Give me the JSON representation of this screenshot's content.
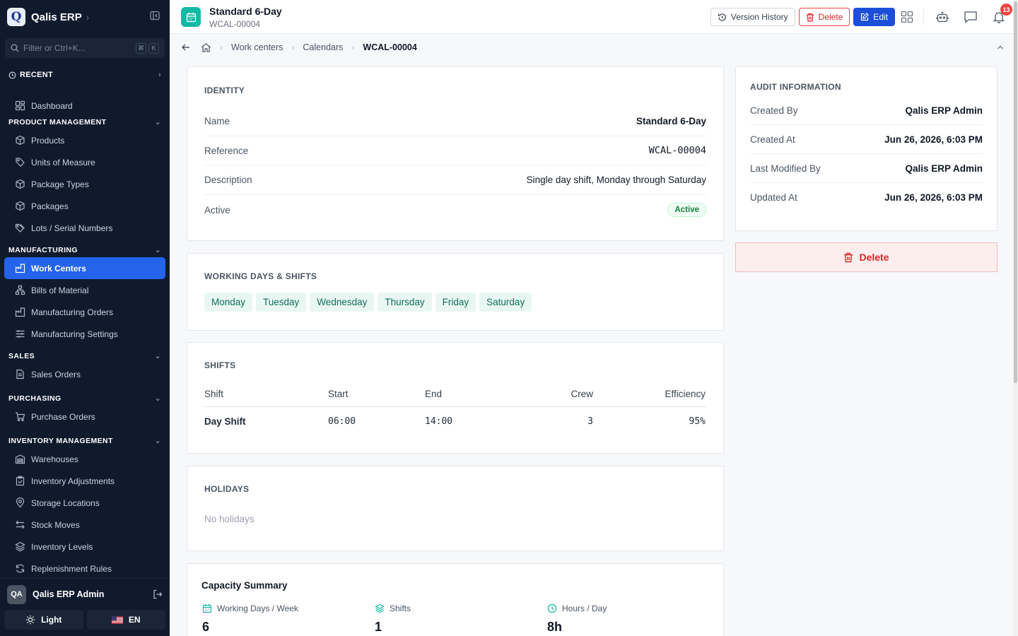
{
  "app": {
    "brand": "Qalis ERP",
    "logo_letter": "Q"
  },
  "sidebar": {
    "search_placeholder": "Filter or Ctrl+K...",
    "kbd1": "⌘",
    "kbd2": "K",
    "recent_label": "RECENT",
    "dashboard": "Dashboard",
    "sections": [
      {
        "title": "PRODUCT MANAGEMENT",
        "items": [
          "Products",
          "Units of Measure",
          "Package Types",
          "Packages",
          "Lots / Serial Numbers"
        ]
      },
      {
        "title": "MANUFACTURING",
        "items": [
          "Work Centers",
          "Bills of Material",
          "Manufacturing Orders",
          "Manufacturing Settings"
        ]
      },
      {
        "title": "SALES",
        "items": [
          "Sales Orders"
        ]
      },
      {
        "title": "PURCHASING",
        "items": [
          "Purchase Orders"
        ]
      },
      {
        "title": "INVENTORY MANAGEMENT",
        "items": [
          "Warehouses",
          "Inventory Adjustments",
          "Storage Locations",
          "Stock Moves",
          "Inventory Levels",
          "Replenishment Rules"
        ]
      }
    ],
    "user": {
      "initials": "QA",
      "name": "Qalis ERP Admin"
    },
    "theme_label": "Light",
    "lang_label": "EN",
    "lang_flag": "🇺🇸"
  },
  "header": {
    "title": "Standard 6-Day",
    "subtitle": "WCAL-00004",
    "version_history": "Version History",
    "delete": "Delete",
    "edit": "Edit",
    "notif_count": "13"
  },
  "breadcrumb": [
    "Work centers",
    "Calendars",
    "WCAL-00004"
  ],
  "identity": {
    "title": "IDENTITY",
    "rows": [
      {
        "k": "Name",
        "v": "Standard 6-Day"
      },
      {
        "k": "Reference",
        "v": "WCAL-00004"
      },
      {
        "k": "Description",
        "v": "Single day shift, Monday through Saturday"
      },
      {
        "k": "Active",
        "v": "Active"
      }
    ]
  },
  "working_days": {
    "title": "WORKING DAYS & SHIFTS",
    "days": [
      "Monday",
      "Tuesday",
      "Wednesday",
      "Thursday",
      "Friday",
      "Saturday"
    ]
  },
  "shifts": {
    "title": "SHIFTS",
    "headers": [
      "Shift",
      "Start",
      "End",
      "Crew",
      "Efficiency"
    ],
    "rows": [
      {
        "name": "Day Shift",
        "start": "06:00",
        "end": "14:00",
        "crew": "3",
        "eff": "95%"
      }
    ]
  },
  "holidays": {
    "title": "HOLIDAYS",
    "empty": "No holidays"
  },
  "capacity": {
    "title": "Capacity Summary",
    "stats": [
      {
        "label": "Working Days / Week",
        "value": "6"
      },
      {
        "label": "Shifts",
        "value": "1"
      },
      {
        "label": "Hours / Day",
        "value": "8h"
      }
    ]
  },
  "audit": {
    "title": "AUDIT INFORMATION",
    "rows": [
      {
        "k": "Created By",
        "v": "Qalis ERP Admin"
      },
      {
        "k": "Created At",
        "v": "Jun 26, 2026, 6:03 PM"
      },
      {
        "k": "Last Modified By",
        "v": "Qalis ERP Admin"
      },
      {
        "k": "Updated At",
        "v": "Jun 26, 2026, 6:03 PM"
      }
    ],
    "delete_label": "Delete"
  },
  "colors": {
    "accent": "#2563eb",
    "sidebar_bg": "#0f1b2d",
    "teal": "#14b8a6",
    "danger": "#dc2626"
  }
}
